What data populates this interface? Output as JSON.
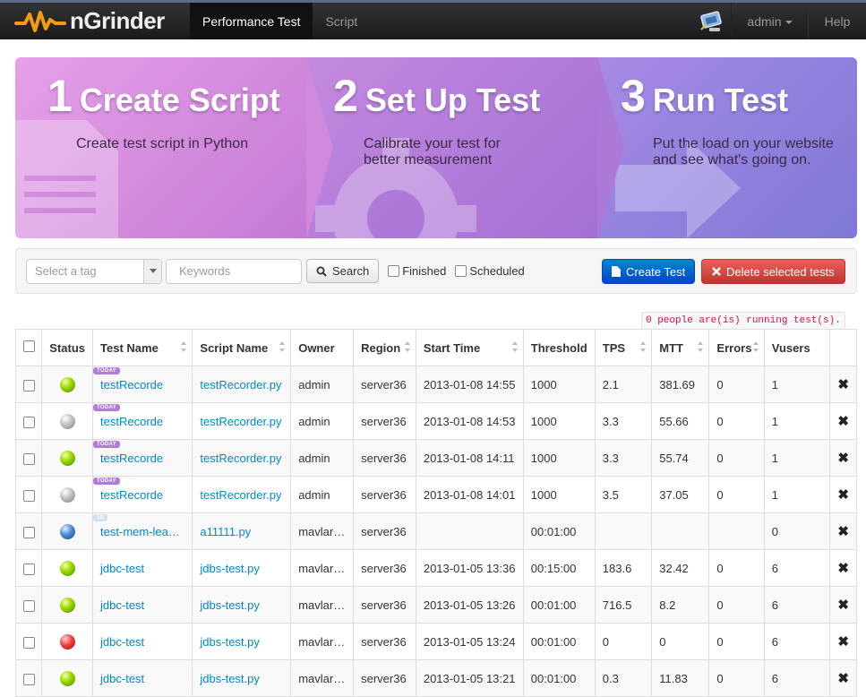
{
  "nav": {
    "brand": "nGrinder",
    "items": [
      "Performance Test",
      "Script"
    ],
    "user": "admin",
    "help": "Help"
  },
  "banner": {
    "steps": [
      {
        "num": "1",
        "title": "Create Script",
        "desc": "Create test script in Python"
      },
      {
        "num": "2",
        "title": "Set Up Test",
        "desc": "Calibrate your test for better measurement"
      },
      {
        "num": "3",
        "title": "Run Test",
        "desc": "Put the load on your website and see what's going on."
      }
    ]
  },
  "toolbar": {
    "tag_placeholder": "Select a tag",
    "keywords_placeholder": "Keywords",
    "search_label": "Search",
    "finished_label": "Finished",
    "scheduled_label": "Scheduled",
    "create_label": "Create Test",
    "delete_label": "Delete selected tests"
  },
  "running_text": "0 people are(is) running test(s).",
  "table": {
    "headers": [
      "Status",
      "Test Name",
      "Script Name",
      "Owner",
      "Region",
      "Start Time",
      "Threshold",
      "TPS",
      "MTT",
      "Errors",
      "Vusers"
    ],
    "rows": [
      {
        "status": "green",
        "tag": "TODAY",
        "name": "testRecorde",
        "script": "testRecorder.py",
        "owner": "admin",
        "region": "server36",
        "start": "2013-01-08 14:55",
        "threshold": "1000",
        "tps": "2.1",
        "mtt": "381.69",
        "errors": "0",
        "vusers": "1"
      },
      {
        "status": "grey",
        "tag": "TODAY",
        "name": "testRecorde",
        "script": "testRecorder.py",
        "owner": "admin",
        "region": "server36",
        "start": "2013-01-08 14:53",
        "threshold": "1000",
        "tps": "3.3",
        "mtt": "55.66",
        "errors": "0",
        "vusers": "1"
      },
      {
        "status": "green",
        "tag": "TODAY",
        "name": "testRecorde",
        "script": "testRecorder.py",
        "owner": "admin",
        "region": "server36",
        "start": "2013-01-08 14:11",
        "threshold": "1000",
        "tps": "3.3",
        "mtt": "55.74",
        "errors": "0",
        "vusers": "1"
      },
      {
        "status": "grey",
        "tag": "TODAY",
        "name": "testRecorde",
        "script": "testRecorder.py",
        "owner": "admin",
        "region": "server36",
        "start": "2013-01-08 14:01",
        "threshold": "1000",
        "tps": "3.5",
        "mtt": "37.05",
        "errors": "0",
        "vusers": "1"
      },
      {
        "status": "blue",
        "tag": "1D",
        "name": "test-mem-lea…",
        "script": "a11111.py",
        "owner": "mavlar…",
        "region": "server36",
        "start": "",
        "threshold": "00:01:00",
        "tps": "",
        "mtt": "",
        "errors": "",
        "vusers": "0"
      },
      {
        "status": "green",
        "tag": "",
        "name": "jdbc-test",
        "script": "jdbs-test.py",
        "owner": "mavlar…",
        "region": "server36",
        "start": "2013-01-05 13:36",
        "threshold": "00:15:00",
        "tps": "183.6",
        "mtt": "32.42",
        "errors": "0",
        "vusers": "6"
      },
      {
        "status": "green",
        "tag": "",
        "name": "jdbc-test",
        "script": "jdbs-test.py",
        "owner": "mavlar…",
        "region": "server36",
        "start": "2013-01-05 13:26",
        "threshold": "00:01:00",
        "tps": "716.5",
        "mtt": "8.2",
        "errors": "0",
        "vusers": "6"
      },
      {
        "status": "red",
        "tag": "",
        "name": "jdbc-test",
        "script": "jdbs-test.py",
        "owner": "mavlar…",
        "region": "server36",
        "start": "2013-01-05 13:24",
        "threshold": "00:01:00",
        "tps": "0",
        "mtt": "0",
        "errors": "0",
        "vusers": "6"
      },
      {
        "status": "green",
        "tag": "",
        "name": "jdbc-test",
        "script": "jdbs-test.py",
        "owner": "mavlar…",
        "region": "server36",
        "start": "2013-01-05 13:21",
        "threshold": "00:01:00",
        "tps": "0.3",
        "mtt": "11.83",
        "errors": "0",
        "vusers": "6"
      }
    ]
  },
  "colors": {
    "accent": "#0088cc",
    "danger": "#bd362f",
    "nav_bg": "#1a1a1a"
  }
}
